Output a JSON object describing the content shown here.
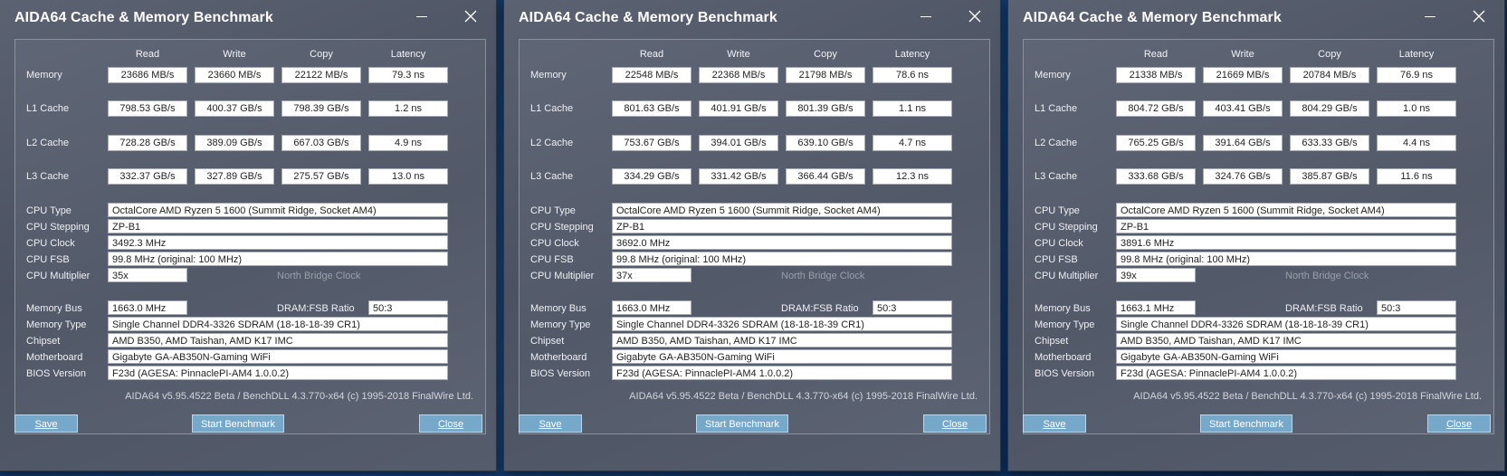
{
  "windows": [
    {
      "title": "AIDA64 Cache & Memory Benchmark",
      "columns": [
        "Read",
        "Write",
        "Copy",
        "Latency"
      ],
      "rows": [
        {
          "label": "Memory",
          "read": "23686 MB/s",
          "write": "23660 MB/s",
          "copy": "22122 MB/s",
          "latency": "79.3 ns"
        },
        {
          "label": "L1 Cache",
          "read": "798.53 GB/s",
          "write": "400.37 GB/s",
          "copy": "798.39 GB/s",
          "latency": "1.2 ns"
        },
        {
          "label": "L2 Cache",
          "read": "728.28 GB/s",
          "write": "389.09 GB/s",
          "copy": "667.03 GB/s",
          "latency": "4.9 ns"
        },
        {
          "label": "L3 Cache",
          "read": "332.37 GB/s",
          "write": "327.89 GB/s",
          "copy": "275.57 GB/s",
          "latency": "13.0 ns"
        }
      ],
      "cpu_type_label": "CPU Type",
      "cpu_type": "OctalCore AMD Ryzen 5 1600  (Summit Ridge, Socket AM4)",
      "cpu_stepping_label": "CPU Stepping",
      "cpu_stepping": "ZP-B1",
      "cpu_clock_label": "CPU Clock",
      "cpu_clock": "3492.3 MHz",
      "cpu_fsb_label": "CPU FSB",
      "cpu_fsb": "99.8 MHz  (original: 100 MHz)",
      "cpu_multiplier_label": "CPU Multiplier",
      "cpu_multiplier": "35x",
      "north_bridge_clock_label": "North Bridge Clock",
      "memory_bus_label": "Memory Bus",
      "memory_bus": "1663.0 MHz",
      "dram_fsb_label": "DRAM:FSB Ratio",
      "dram_fsb": "50:3",
      "memory_type_label": "Memory Type",
      "memory_type": "Single Channel DDR4-3326 SDRAM  (18-18-18-39 CR1)",
      "chipset_label": "Chipset",
      "chipset": "AMD B350, AMD Taishan, AMD K17 IMC",
      "motherboard_label": "Motherboard",
      "motherboard": "Gigabyte GA-AB350N-Gaming WiFi",
      "bios_label": "BIOS Version",
      "bios": "F23d  (AGESA: PinnaclePI-AM4 1.0.0.2)",
      "footer": "AIDA64 v5.95.4522 Beta / BenchDLL 4.3.770-x64  (c) 1995-2018 FinalWire Ltd.",
      "save_label": "Save",
      "start_label": "Start Benchmark",
      "close_label": "Close"
    },
    {
      "title": "AIDA64 Cache & Memory Benchmark",
      "columns": [
        "Read",
        "Write",
        "Copy",
        "Latency"
      ],
      "rows": [
        {
          "label": "Memory",
          "read": "22548 MB/s",
          "write": "22368 MB/s",
          "copy": "21798 MB/s",
          "latency": "78.6 ns"
        },
        {
          "label": "L1 Cache",
          "read": "801.63 GB/s",
          "write": "401.91 GB/s",
          "copy": "801.39 GB/s",
          "latency": "1.1 ns"
        },
        {
          "label": "L2 Cache",
          "read": "753.67 GB/s",
          "write": "394.01 GB/s",
          "copy": "639.10 GB/s",
          "latency": "4.7 ns"
        },
        {
          "label": "L3 Cache",
          "read": "334.29 GB/s",
          "write": "331.42 GB/s",
          "copy": "366.44 GB/s",
          "latency": "12.3 ns"
        }
      ],
      "cpu_type_label": "CPU Type",
      "cpu_type": "OctalCore AMD Ryzen 5 1600  (Summit Ridge, Socket AM4)",
      "cpu_stepping_label": "CPU Stepping",
      "cpu_stepping": "ZP-B1",
      "cpu_clock_label": "CPU Clock",
      "cpu_clock": "3692.0 MHz",
      "cpu_fsb_label": "CPU FSB",
      "cpu_fsb": "99.8 MHz  (original: 100 MHz)",
      "cpu_multiplier_label": "CPU Multiplier",
      "cpu_multiplier": "37x",
      "north_bridge_clock_label": "North Bridge Clock",
      "memory_bus_label": "Memory Bus",
      "memory_bus": "1663.0 MHz",
      "dram_fsb_label": "DRAM:FSB Ratio",
      "dram_fsb": "50:3",
      "memory_type_label": "Memory Type",
      "memory_type": "Single Channel DDR4-3326 SDRAM  (18-18-18-39 CR1)",
      "chipset_label": "Chipset",
      "chipset": "AMD B350, AMD Taishan, AMD K17 IMC",
      "motherboard_label": "Motherboard",
      "motherboard": "Gigabyte GA-AB350N-Gaming WiFi",
      "bios_label": "BIOS Version",
      "bios": "F23d  (AGESA: PinnaclePI-AM4 1.0.0.2)",
      "footer": "AIDA64 v5.95.4522 Beta / BenchDLL 4.3.770-x64  (c) 1995-2018 FinalWire Ltd.",
      "save_label": "Save",
      "start_label": "Start Benchmark",
      "close_label": "Close"
    },
    {
      "title": "AIDA64 Cache & Memory Benchmark",
      "columns": [
        "Read",
        "Write",
        "Copy",
        "Latency"
      ],
      "rows": [
        {
          "label": "Memory",
          "read": "21338 MB/s",
          "write": "21669 MB/s",
          "copy": "20784 MB/s",
          "latency": "76.9 ns"
        },
        {
          "label": "L1 Cache",
          "read": "804.72 GB/s",
          "write": "403.41 GB/s",
          "copy": "804.29 GB/s",
          "latency": "1.0 ns"
        },
        {
          "label": "L2 Cache",
          "read": "765.25 GB/s",
          "write": "391.64 GB/s",
          "copy": "633.33 GB/s",
          "latency": "4.4 ns"
        },
        {
          "label": "L3 Cache",
          "read": "333.68 GB/s",
          "write": "324.76 GB/s",
          "copy": "385.87 GB/s",
          "latency": "11.6 ns"
        }
      ],
      "cpu_type_label": "CPU Type",
      "cpu_type": "OctalCore AMD Ryzen 5 1600  (Summit Ridge, Socket AM4)",
      "cpu_stepping_label": "CPU Stepping",
      "cpu_stepping": "ZP-B1",
      "cpu_clock_label": "CPU Clock",
      "cpu_clock": "3891.6 MHz",
      "cpu_fsb_label": "CPU FSB",
      "cpu_fsb": "99.8 MHz  (original: 100 MHz)",
      "cpu_multiplier_label": "CPU Multiplier",
      "cpu_multiplier": "39x",
      "north_bridge_clock_label": "North Bridge Clock",
      "memory_bus_label": "Memory Bus",
      "memory_bus": "1663.1 MHz",
      "dram_fsb_label": "DRAM:FSB Ratio",
      "dram_fsb": "50:3",
      "memory_type_label": "Memory Type",
      "memory_type": "Single Channel DDR4-3326 SDRAM  (18-18-18-39 CR1)",
      "chipset_label": "Chipset",
      "chipset": "AMD B350, AMD Taishan, AMD K17 IMC",
      "motherboard_label": "Motherboard",
      "motherboard": "Gigabyte GA-AB350N-Gaming WiFi",
      "bios_label": "BIOS Version",
      "bios": "F23d  (AGESA: PinnaclePI-AM4 1.0.0.2)",
      "footer": "AIDA64 v5.95.4522 Beta / BenchDLL 4.3.770-x64  (c) 1995-2018 FinalWire Ltd.",
      "save_label": "Save",
      "start_label": "Start Benchmark",
      "close_label": "Close"
    }
  ]
}
